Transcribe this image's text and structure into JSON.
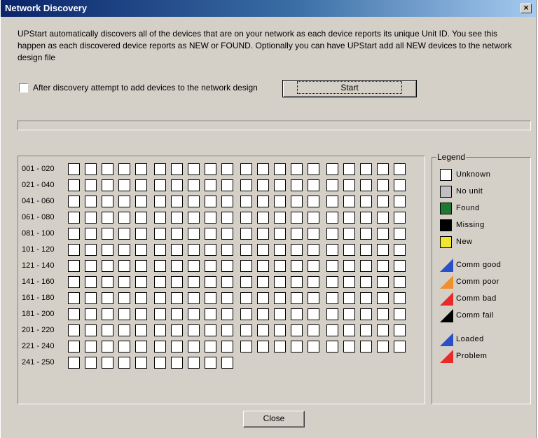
{
  "window": {
    "title": "Network Discovery",
    "close_glyph": "×"
  },
  "intro_text": "UPStart automatically discovers all of the devices that are on your network as each device reports its unique Unit ID.  You see this happen as each discovered device reports as NEW or FOUND.  Optionally you can have UPStart add all NEW devices to the network design file",
  "add_devices": {
    "label": "After discovery attempt to add devices to the network design",
    "checked": false
  },
  "start_label": "Start",
  "progress": 0,
  "grid": {
    "rows": [
      {
        "label": "001 - 020",
        "count": 20
      },
      {
        "label": "021 - 040",
        "count": 20
      },
      {
        "label": "041 - 060",
        "count": 20
      },
      {
        "label": "061 - 080",
        "count": 20
      },
      {
        "label": "081 - 100",
        "count": 20
      },
      {
        "label": "101 - 120",
        "count": 20
      },
      {
        "label": "121 - 140",
        "count": 20
      },
      {
        "label": "141 - 160",
        "count": 20
      },
      {
        "label": "161 - 180",
        "count": 20
      },
      {
        "label": "181 - 200",
        "count": 20
      },
      {
        "label": "201 - 220",
        "count": 20
      },
      {
        "label": "221 - 240",
        "count": 20
      },
      {
        "label": "241 - 250",
        "count": 10
      }
    ],
    "unit_state": "Unknown"
  },
  "legend": {
    "title": "Legend",
    "status_items": [
      {
        "label": "Unknown",
        "color": "#ffffff"
      },
      {
        "label": "No unit",
        "color": "#c0c0c0"
      },
      {
        "label": "Found",
        "color": "#1e7a32"
      },
      {
        "label": "Missing",
        "color": "#000000"
      },
      {
        "label": "New",
        "color": "#f0e630"
      }
    ],
    "comm_items": [
      {
        "label": "Comm good",
        "color": "#2a4fc8"
      },
      {
        "label": "Comm poor",
        "color": "#f0902a"
      },
      {
        "label": "Comm bad",
        "color": "#e82a2a"
      },
      {
        "label": "Comm fail",
        "color": "#000000"
      }
    ],
    "load_items": [
      {
        "label": "Loaded",
        "color": "#2a4fc8"
      },
      {
        "label": "Problem",
        "color": "#e82a2a"
      }
    ]
  },
  "close_label": "Close"
}
